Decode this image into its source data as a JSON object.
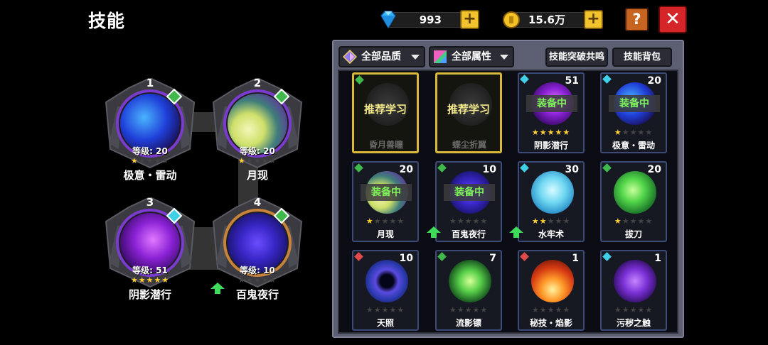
{
  "page": {
    "title": "技能"
  },
  "currency": {
    "diamond": {
      "value": "993",
      "icon": "diamond-icon"
    },
    "gold": {
      "value": "15.6万",
      "icon": "gold-coin-icon"
    },
    "plus_label": "+"
  },
  "buttons": {
    "help_label": "?",
    "close_label": "✕"
  },
  "slots": [
    {
      "number": "1",
      "level": "等级: 20",
      "name": "极意・雷动",
      "stars": "★☆☆☆☆",
      "gem": "green",
      "orb": "lightning"
    },
    {
      "number": "2",
      "level": "等级: 20",
      "name": "月现",
      "stars": "★☆☆☆☆",
      "gem": "green",
      "orb": "moon"
    },
    {
      "number": "3",
      "level": "等级: 51",
      "name": "阴影潜行",
      "stars": "★★★★★",
      "gem": "cyan",
      "orb": "shadow"
    },
    {
      "number": "4",
      "level": "等级: 10",
      "name": "百鬼夜行",
      "stars": "☆☆☆☆☆",
      "gem": "green",
      "orb": "demon"
    }
  ],
  "filters": {
    "quality": "全部品质",
    "attribute": "全部属性",
    "breakthrough": "技能突破共鸣",
    "backpack": "技能背包"
  },
  "cards": [
    {
      "name": "昏月兽瞳",
      "count": "",
      "rec": "推荐学习",
      "equipped": "",
      "stars": "",
      "gem": "green",
      "orb": "grey",
      "up": false
    },
    {
      "name": "蝶尘折翼",
      "count": "",
      "rec": "推荐学习",
      "equipped": "",
      "stars": "",
      "gem": "",
      "orb": "grey",
      "up": false
    },
    {
      "name": "阴影潜行",
      "count": "51",
      "rec": "",
      "equipped": "装备中",
      "stars": "★★★★★",
      "gem": "cyan",
      "orb": "shadow",
      "up": false
    },
    {
      "name": "极意・雷动",
      "count": "20",
      "rec": "",
      "equipped": "装备中",
      "stars": "★☆☆☆☆",
      "gem": "cyan",
      "orb": "lightning",
      "up": false
    },
    {
      "name": "月现",
      "count": "20",
      "rec": "",
      "equipped": "装备中",
      "stars": "★☆☆☆☆",
      "gem": "green",
      "orb": "moon",
      "up": false
    },
    {
      "name": "百鬼夜行",
      "count": "10",
      "rec": "",
      "equipped": "装备中",
      "stars": "☆☆☆☆☆",
      "gem": "green",
      "orb": "demon",
      "up": true
    },
    {
      "name": "水牢术",
      "count": "30",
      "rec": "",
      "equipped": "",
      "stars": "★★☆☆☆",
      "gem": "cyan",
      "orb": "water",
      "up": true
    },
    {
      "name": "拔刀",
      "count": "20",
      "rec": "",
      "equipped": "",
      "stars": "★☆☆☆☆",
      "gem": "green",
      "orb": "blade",
      "up": false
    },
    {
      "name": "天照",
      "count": "10",
      "rec": "",
      "equipped": "",
      "stars": "☆☆☆☆☆",
      "gem": "red",
      "orb": "eclipse",
      "up": false
    },
    {
      "name": "流影镖",
      "count": "7",
      "rec": "",
      "equipped": "",
      "stars": "☆☆☆☆☆",
      "gem": "green",
      "orb": "shuriken",
      "up": false
    },
    {
      "name": "秘技・焰影",
      "count": "1",
      "rec": "",
      "equipped": "",
      "stars": "☆☆☆☆☆",
      "gem": "red",
      "orb": "flame",
      "up": false
    },
    {
      "name": "污秽之触",
      "count": "1",
      "rec": "",
      "equipped": "",
      "stars": "☆☆☆☆☆",
      "gem": "cyan",
      "orb": "corrupt",
      "up": false
    }
  ],
  "colors": {
    "gem_green": "#3fb94c",
    "gem_cyan": "#3fd0e8",
    "gem_red": "#e04a4a",
    "equipped_text": "#7ef35a",
    "star_on": "#ffcf33",
    "close": "#d52528",
    "plus": "#f3c32e"
  }
}
